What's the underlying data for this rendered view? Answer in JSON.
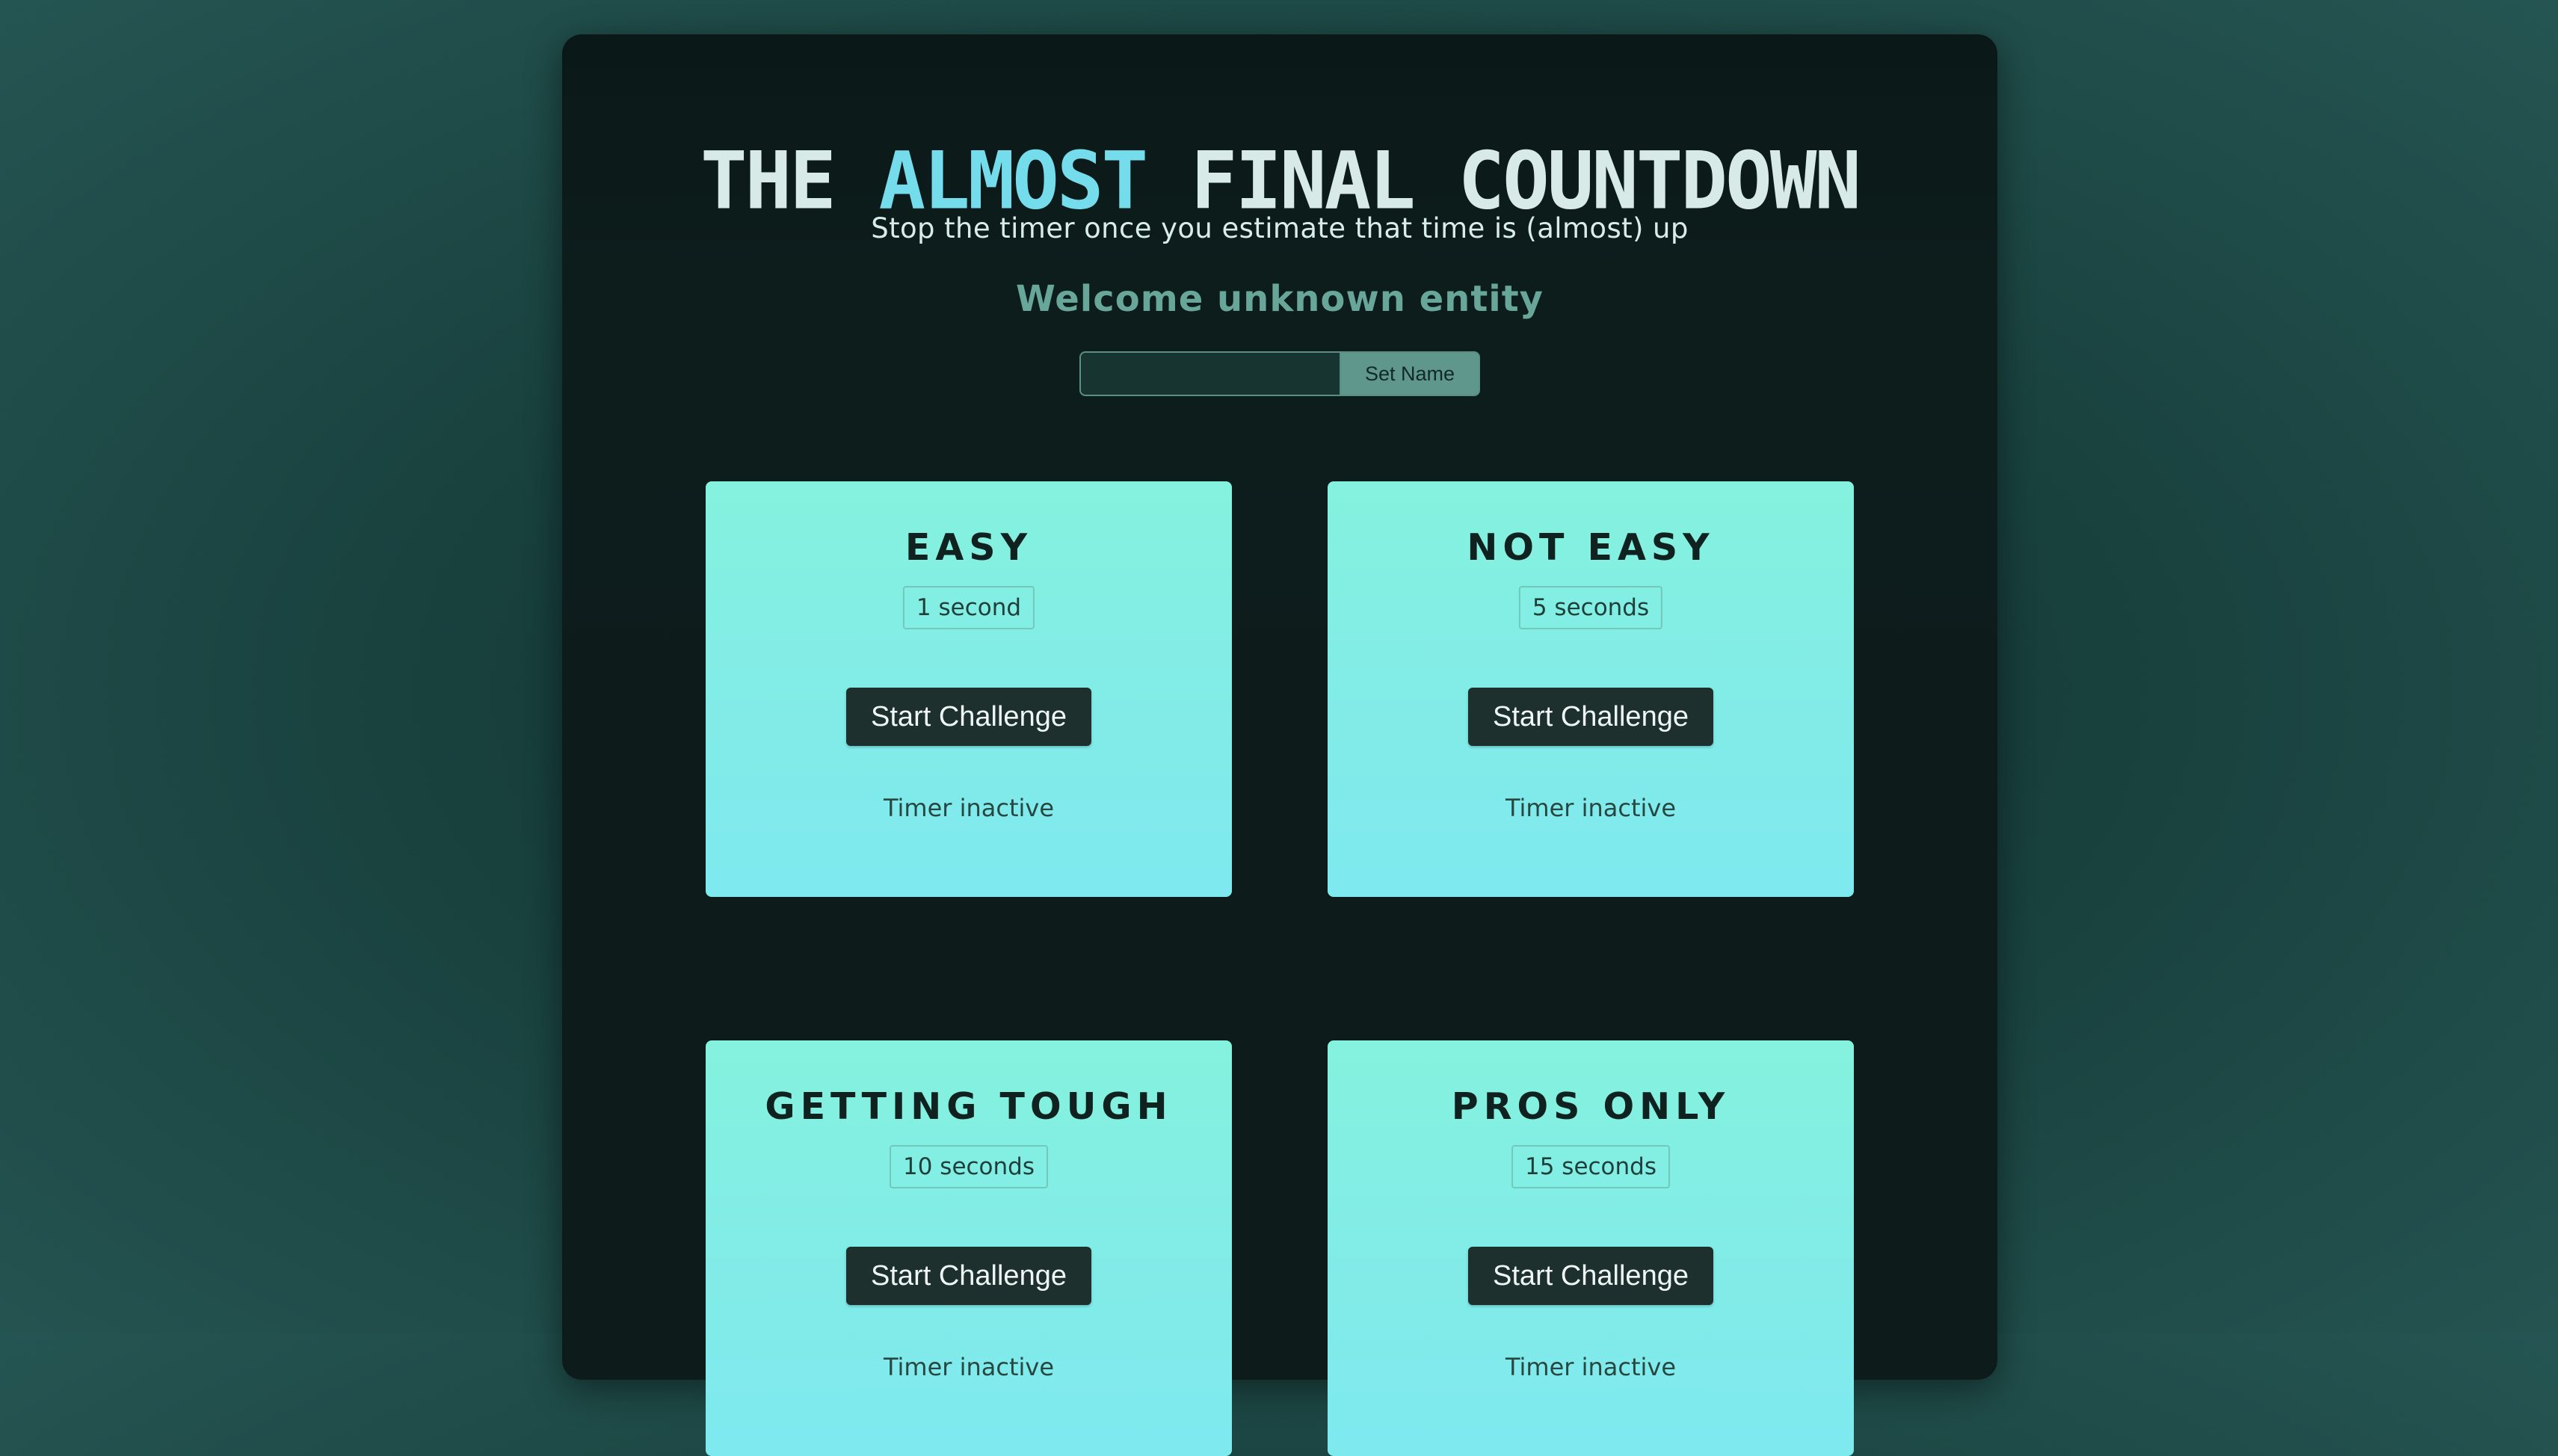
{
  "header": {
    "title_part1": "THE",
    "title_accent": "ALMOST",
    "title_part2": "FINAL COUNTDOWN",
    "subtitle": "Stop the timer once you estimate that time is (almost) up",
    "welcome": "Welcome unknown entity"
  },
  "name_form": {
    "input_value": "",
    "input_placeholder": "",
    "button_label": "Set Name"
  },
  "challenges": [
    {
      "title": "EASY",
      "duration": "1 second",
      "button_label": "Start Challenge",
      "status": "Timer inactive"
    },
    {
      "title": "NOT EASY",
      "duration": "5 seconds",
      "button_label": "Start Challenge",
      "status": "Timer inactive"
    },
    {
      "title": "GETTING TOUGH",
      "duration": "10 seconds",
      "button_label": "Start Challenge",
      "status": "Timer inactive"
    },
    {
      "title": "PROS ONLY",
      "duration": "15 seconds",
      "button_label": "Start Challenge",
      "status": "Timer inactive"
    }
  ],
  "colors": {
    "page_background": "#255552",
    "panel_background": "#0d1b1a",
    "accent": "#74dceb",
    "card_gradient_top": "#84f2de",
    "card_gradient_bottom": "#7eeaf0",
    "button_background": "#1d302d",
    "welcome_text": "#69a69a"
  }
}
